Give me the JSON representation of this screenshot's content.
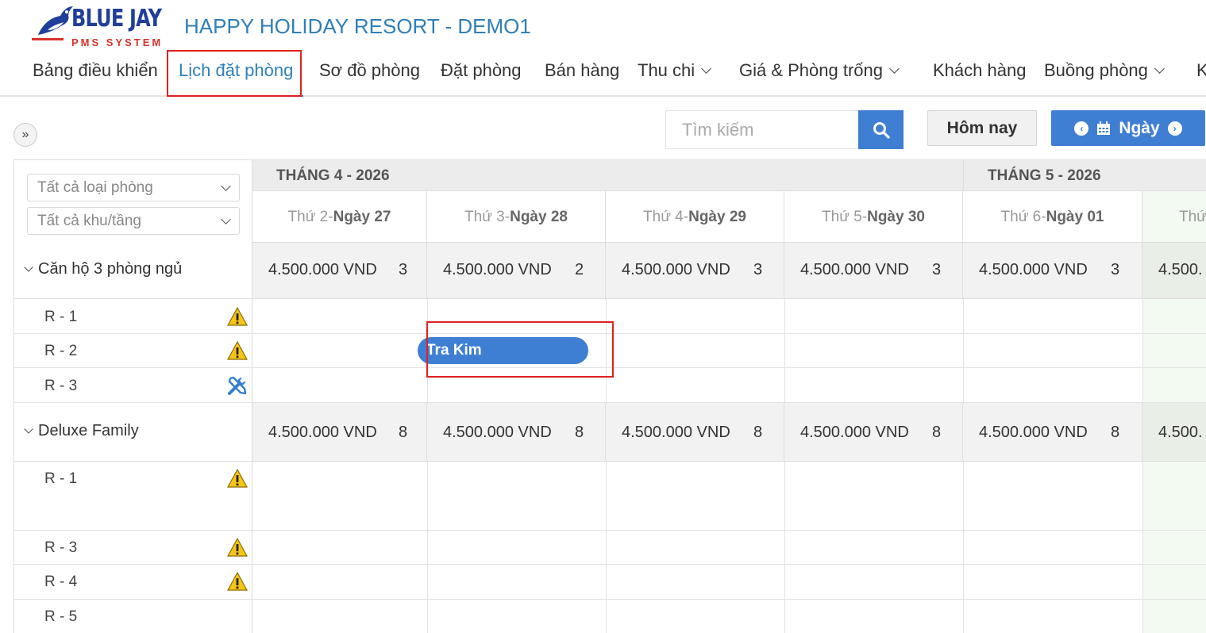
{
  "logo": {
    "line1": "BLUE JAY",
    "line2": "PMS SYSTEM"
  },
  "hotel_title": "HAPPY HOLIDAY RESORT - DEMO1",
  "nav": [
    {
      "label": "Bảng điều khiển"
    },
    {
      "label": "Lịch đặt phòng",
      "active": true
    },
    {
      "label": "Sơ đồ phòng"
    },
    {
      "label": "Đặt phòng"
    },
    {
      "label": "Bán hàng"
    },
    {
      "label": "Thu chi",
      "dropdown": true
    },
    {
      "label": "Giá & Phòng trống",
      "dropdown": true
    },
    {
      "label": "Khách hàng"
    },
    {
      "label": "Buồng phòng",
      "dropdown": true
    },
    {
      "label": "K"
    }
  ],
  "toolbar": {
    "expand_label": "»",
    "search_placeholder": "Tìm kiếm",
    "today_label": "Hôm nay",
    "day_label": "Ngày"
  },
  "filters": {
    "room_type": "Tất cả loại phòng",
    "area": "Tất cả khu/tầng"
  },
  "months": [
    "THÁNG 4 - 2026",
    "THÁNG 5 - 2026"
  ],
  "days": [
    {
      "weekday": "Thứ 2-",
      "date": "Ngày 27"
    },
    {
      "weekday": "Thứ 3-",
      "date": "Ngày 28"
    },
    {
      "weekday": "Thứ 4-",
      "date": "Ngày 29"
    },
    {
      "weekday": "Thứ 5-",
      "date": "Ngày 30"
    },
    {
      "weekday": "Thứ 6-",
      "date": "Ngày 01"
    },
    {
      "weekday": "Thứ",
      "date": ""
    }
  ],
  "groups": [
    {
      "name": "Căn hộ 3 phòng ngủ",
      "prices": [
        {
          "price": "4.500.000 VND",
          "count": "3"
        },
        {
          "price": "4.500.000 VND",
          "count": "2"
        },
        {
          "price": "4.500.000 VND",
          "count": "3"
        },
        {
          "price": "4.500.000 VND",
          "count": "3"
        },
        {
          "price": "4.500.000 VND",
          "count": "3"
        },
        {
          "price": "4.500.",
          "count": ""
        }
      ],
      "rooms": [
        {
          "name": "R - 1",
          "icon": "warning-icon"
        },
        {
          "name": "R - 2",
          "icon": "warning-icon"
        },
        {
          "name": "R - 3",
          "icon": "tools-icon"
        }
      ]
    },
    {
      "name": "Deluxe Family",
      "prices": [
        {
          "price": "4.500.000 VND",
          "count": "8"
        },
        {
          "price": "4.500.000 VND",
          "count": "8"
        },
        {
          "price": "4.500.000 VND",
          "count": "8"
        },
        {
          "price": "4.500.000 VND",
          "count": "8"
        },
        {
          "price": "4.500.000 VND",
          "count": "8"
        },
        {
          "price": "4.500.",
          "count": ""
        }
      ],
      "rooms": [
        {
          "name": "R - 1",
          "icon": "warning-icon"
        },
        {
          "name": "R - 3",
          "icon": "warning-icon"
        },
        {
          "name": "R - 4",
          "icon": "warning-icon"
        },
        {
          "name": "R - 5",
          "icon": ""
        }
      ]
    }
  ],
  "booking": {
    "guest": "Tra Kim"
  },
  "colors": {
    "primary": "#3f7fd3",
    "title": "#2f7fb8",
    "highlight": "#e02020"
  }
}
